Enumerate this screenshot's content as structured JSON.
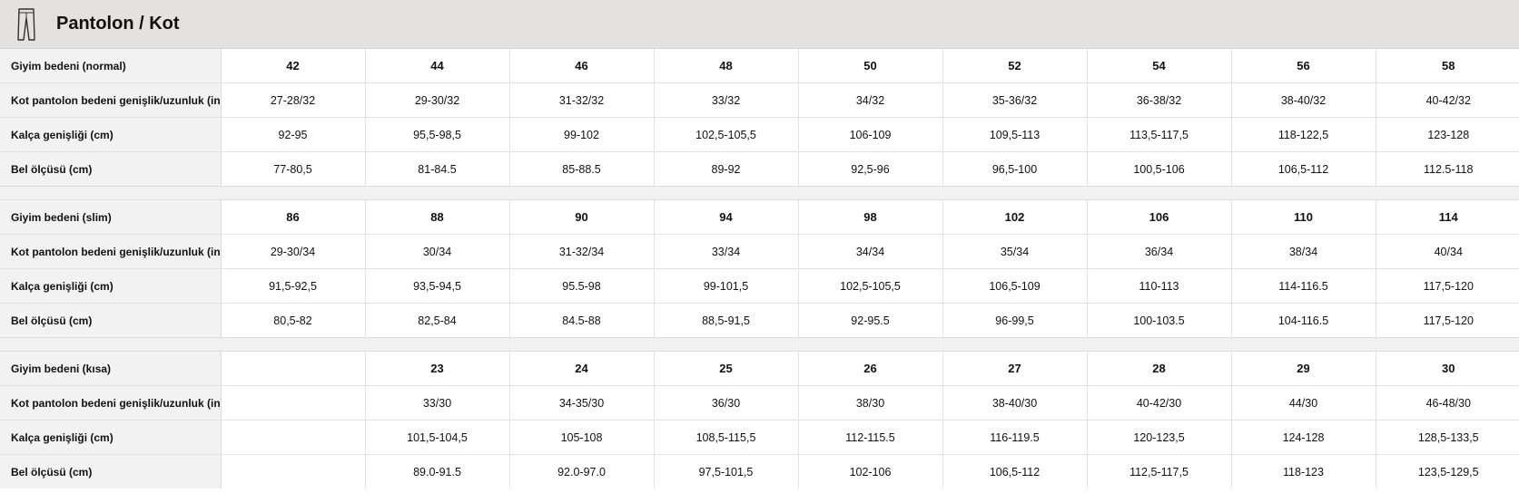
{
  "header": {
    "title": "Pantolon / Kot",
    "icon": "trousers-icon"
  },
  "tables": [
    {
      "rows": [
        {
          "label": "Giyim bedeni (normal)",
          "cells": [
            "42",
            "44",
            "46",
            "48",
            "50",
            "52",
            "54",
            "56",
            "58"
          ]
        },
        {
          "label": "Kot pantolon bedeni genişlik/uzunluk (inç)",
          "cells": [
            "27-28/32",
            "29-30/32",
            "31-32/32",
            "33/32",
            "34/32",
            "35-36/32",
            "36-38/32",
            "38-40/32",
            "40-42/32"
          ]
        },
        {
          "label": "Kalça genişliği (cm)",
          "cells": [
            "92-95",
            "95,5-98,5",
            "99-102",
            "102,5-105,5",
            "106-109",
            "109,5-113",
            "113,5-117,5",
            "118-122,5",
            "123-128"
          ]
        },
        {
          "label": "Bel ölçüsü (cm)",
          "cells": [
            "77-80,5",
            "81-84.5",
            "85-88.5",
            "89-92",
            "92,5-96",
            "96,5-100",
            "100,5-106",
            "106,5-112",
            "112.5-118"
          ]
        }
      ]
    },
    {
      "rows": [
        {
          "label": "Giyim bedeni (slim)",
          "cells": [
            "86",
            "88",
            "90",
            "94",
            "98",
            "102",
            "106",
            "110",
            "114"
          ]
        },
        {
          "label": "Kot pantolon bedeni genişlik/uzunluk (inç)",
          "cells": [
            "29-30/34",
            "30/34",
            "31-32/34",
            "33/34",
            "34/34",
            "35/34",
            "36/34",
            "38/34",
            "40/34"
          ]
        },
        {
          "label": "Kalça genişliği (cm)",
          "cells": [
            "91,5-92,5",
            "93,5-94,5",
            "95.5-98",
            "99-101,5",
            "102,5-105,5",
            "106,5-109",
            "110-113",
            "114-116.5",
            "117,5-120"
          ]
        },
        {
          "label": "Bel ölçüsü (cm)",
          "cells": [
            "80,5-82",
            "82,5-84",
            "84.5-88",
            "88,5-91,5",
            "92-95.5",
            "96-99,5",
            "100-103.5",
            "104-116.5",
            "117,5-120"
          ]
        }
      ]
    },
    {
      "rows": [
        {
          "label": "Giyim bedeni (kısa)",
          "cells": [
            "",
            "23",
            "24",
            "25",
            "26",
            "27",
            "28",
            "29",
            "30"
          ]
        },
        {
          "label": "Kot pantolon bedeni genişlik/uzunluk (inç)",
          "cells": [
            "",
            "33/30",
            "34-35/30",
            "36/30",
            "38/30",
            "38-40/30",
            "40-42/30",
            "44/30",
            "46-48/30"
          ]
        },
        {
          "label": "Kalça genişliği (cm)",
          "cells": [
            "",
            "101,5-104,5",
            "105-108",
            "108,5-115,5",
            "112-115.5",
            "116-119.5",
            "120-123,5",
            "124-128",
            "128,5-133,5"
          ]
        },
        {
          "label": "Bel ölçüsü (cm)",
          "cells": [
            "",
            "89.0-91.5",
            "92.0-97.0",
            "97,5-101,5",
            "102-106",
            "106,5-112",
            "112,5-117,5",
            "118-123",
            "123,5-129,5"
          ]
        }
      ]
    }
  ]
}
